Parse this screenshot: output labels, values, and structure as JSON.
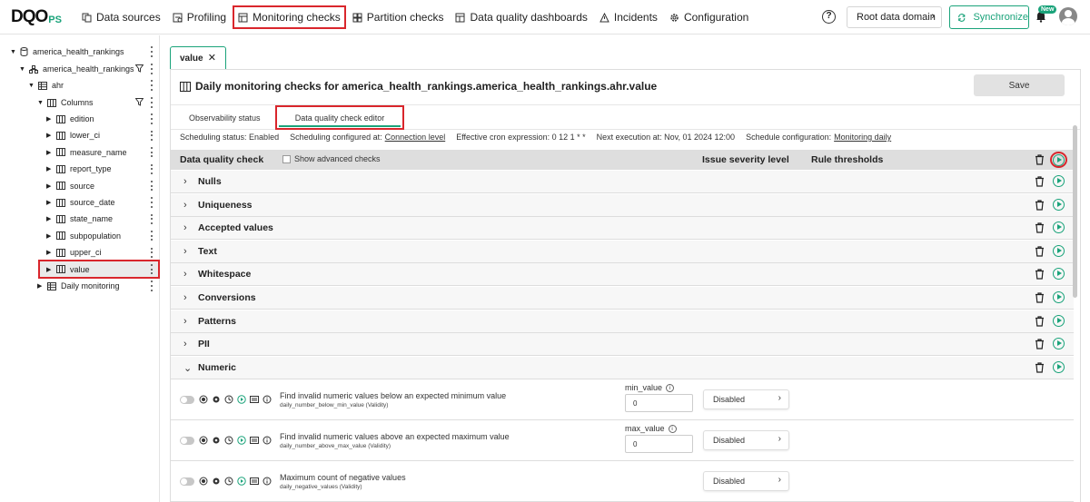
{
  "logo": {
    "main": "DQO",
    "suffix": "PS"
  },
  "nav": [
    {
      "label": "Data sources",
      "icon": "data-sources-icon"
    },
    {
      "label": "Profiling",
      "icon": "profiling-icon"
    },
    {
      "label": "Monitoring checks",
      "icon": "monitoring-icon"
    },
    {
      "label": "Partition checks",
      "icon": "partition-icon"
    },
    {
      "label": "Data quality dashboards",
      "icon": "dashboard-icon"
    },
    {
      "label": "Incidents",
      "icon": "warning-icon"
    },
    {
      "label": "Configuration",
      "icon": "gear-icon"
    }
  ],
  "header": {
    "help": "?",
    "root_domain": "Root data domain",
    "sync": "Synchronize",
    "new_badge": "New"
  },
  "tree": {
    "connection": "america_health_rankings",
    "schema": "america_health_rankings",
    "table": "ahr",
    "columns_folder": "Columns",
    "columns": [
      "edition",
      "lower_ci",
      "measure_name",
      "report_type",
      "source",
      "source_date",
      "state_name",
      "subpopulation",
      "upper_ci",
      "value"
    ],
    "daily": "Daily monitoring"
  },
  "main": {
    "tab_label": "value",
    "title": "Daily monitoring checks for america_health_rankings.america_health_rankings.ahr.value",
    "save": "Save",
    "subtabs": [
      "Observability status",
      "Data quality check editor"
    ],
    "schedule": {
      "status": "Scheduling status: Enabled",
      "configured_prefix": "Scheduling configured at:",
      "configured_link": "Connection level",
      "cron": "Effective cron expression: 0 12 1 * *",
      "next": "Next execution at: Nov, 01 2024 12:00",
      "config_prefix": "Schedule configuration:",
      "config_link": "Monitoring daily"
    },
    "grid_headers": {
      "check": "Data quality check",
      "advanced": "Show advanced checks",
      "severity": "Issue severity level",
      "rule": "Rule thresholds"
    },
    "categories": [
      "Nulls",
      "Uniqueness",
      "Accepted values",
      "Text",
      "Whitespace",
      "Conversions",
      "Patterns",
      "PII",
      "Numeric"
    ],
    "checks": [
      {
        "title": "Find invalid numeric values below an expected minimum value",
        "sub": "daily_number_below_min_value (Validity)",
        "param": "min_value",
        "value": "0",
        "severity": "Disabled"
      },
      {
        "title": "Find invalid numeric values above an expected maximum value",
        "sub": "daily_number_above_max_value (Validity)",
        "param": "max_value",
        "value": "0",
        "severity": "Disabled"
      },
      {
        "title": "Maximum count of negative values",
        "sub": "daily_negative_values (Validity)",
        "param": "",
        "value": "",
        "severity": "Disabled"
      }
    ]
  },
  "colors": {
    "accent": "#1aa37a",
    "highlight": "#d9262c"
  }
}
